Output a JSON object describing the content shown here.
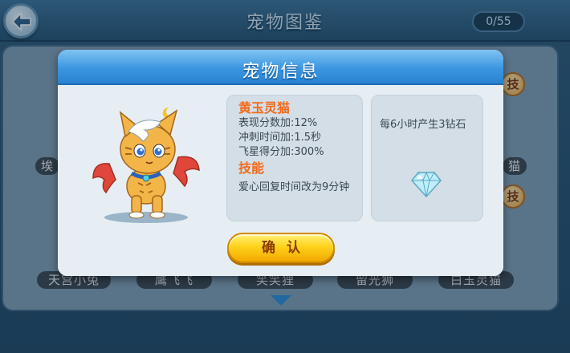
{
  "background": {
    "title": "宠物图鉴",
    "collected_count": "0/55",
    "skill_badge_label": "技",
    "pet_names_row2": [
      "天宫小兔",
      "鹰飞飞",
      "笑笑狸",
      "留光狮",
      "白玉灵猫"
    ],
    "pet_name_row1_left": "埃",
    "pet_name_row1_right": "猫"
  },
  "dialog": {
    "title": "宠物信息",
    "pet": {
      "name": "黄玉灵猫",
      "stats": [
        "表现分数加:12%",
        "冲刺时间加:1.5秒",
        "飞星得分加:300%"
      ],
      "skill_heading": "技能",
      "skill_description": "爱心回复时间改为9分钟"
    },
    "bonus_text": "每6小时产生3钻石",
    "confirm_label": "确认"
  },
  "colors": {
    "header_blue": "#3c96e0",
    "accent_orange": "#f26a1b",
    "button_yellow": "#ffd21b"
  },
  "icons": [
    "back-arrow-icon",
    "pet-yellow-cat",
    "diamond-icon",
    "scroll-down-arrow-icon"
  ]
}
